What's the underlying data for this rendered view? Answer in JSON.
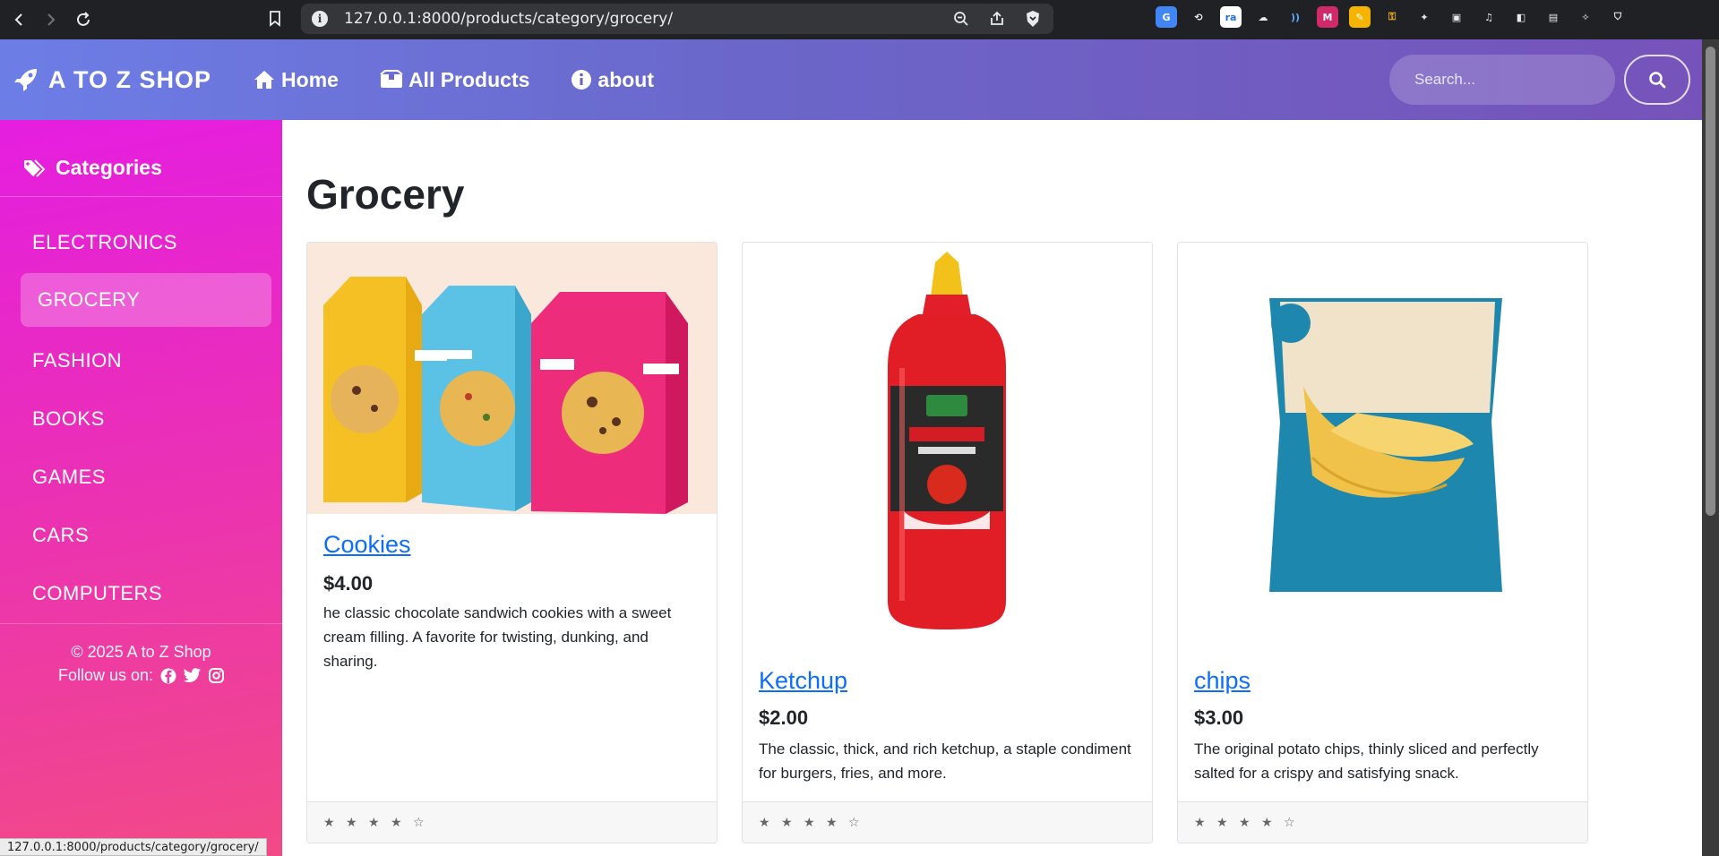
{
  "browser": {
    "url": "127.0.0.1:8000/products/category/grocery/",
    "status_url": "127.0.0.1:8000/products/category/grocery/"
  },
  "navbar": {
    "brand": "A TO Z SHOP",
    "links": [
      "Home",
      "All Products",
      "about"
    ],
    "search_placeholder": "Search..."
  },
  "sidebar": {
    "title": "Categories",
    "categories": [
      "ELECTRONICS",
      "GROCERY",
      "FASHION",
      "BOOKS",
      "GAMES",
      "CARS",
      "COMPUTERS"
    ],
    "active": "GROCERY",
    "copyright": "© 2025 A to Z Shop",
    "follow": "Follow us on:"
  },
  "main": {
    "title": "Grocery",
    "products": [
      {
        "name": "Cookies",
        "price": "$4.00",
        "description": "he classic chocolate sandwich cookies with a sweet cream filling. A favorite for twisting, dunking, and sharing.",
        "rating": "★ ★ ★ ★ ☆"
      },
      {
        "name": "Ketchup",
        "price": "$2.00",
        "description": "The classic, thick, and rich ketchup, a staple condiment for burgers, fries, and more.",
        "rating": "★ ★ ★ ★ ☆"
      },
      {
        "name": "chips",
        "price": "$3.00",
        "description": "The original potato chips, thinly sliced and perfectly salted for a crispy and satisfying snack.",
        "rating": "★ ★ ★ ★ ☆"
      }
    ]
  },
  "colors": {
    "navbar_start": "#6c7ee6",
    "navbar_end": "#7653ba",
    "sidebar_start": "#e51ee0",
    "sidebar_end": "#f24a86",
    "link": "#0d6efd"
  }
}
